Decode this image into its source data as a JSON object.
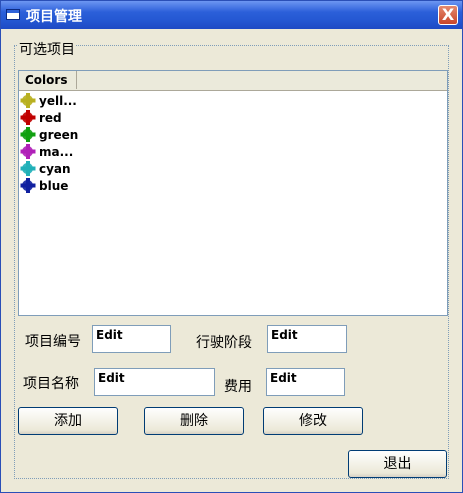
{
  "window": {
    "title": "项目管理",
    "close_label": "X"
  },
  "group": {
    "label": "可选项目"
  },
  "list": {
    "column": "Colors",
    "items": [
      {
        "label": "yell...",
        "icon": "yellow-icon",
        "color": "#b8b020"
      },
      {
        "label": "red",
        "icon": "red-icon",
        "color": "#c00000"
      },
      {
        "label": "green",
        "icon": "green-icon",
        "color": "#10a010"
      },
      {
        "label": "ma...",
        "icon": "magenta-icon",
        "color": "#b020b8"
      },
      {
        "label": "cyan",
        "icon": "cyan-icon",
        "color": "#20b0b8"
      },
      {
        "label": "blue",
        "icon": "blue-icon",
        "color": "#1020a0"
      }
    ]
  },
  "form": {
    "project_no_label": "项目编号",
    "project_no_value": "Edit",
    "stage_label": "行驶阶段",
    "stage_value": "Edit",
    "project_name_label": "项目名称",
    "project_name_value": "Edit",
    "cost_label": "费用",
    "cost_value": "Edit"
  },
  "buttons": {
    "add": "添加",
    "delete": "删除",
    "modify": "修改",
    "exit": "退出"
  }
}
